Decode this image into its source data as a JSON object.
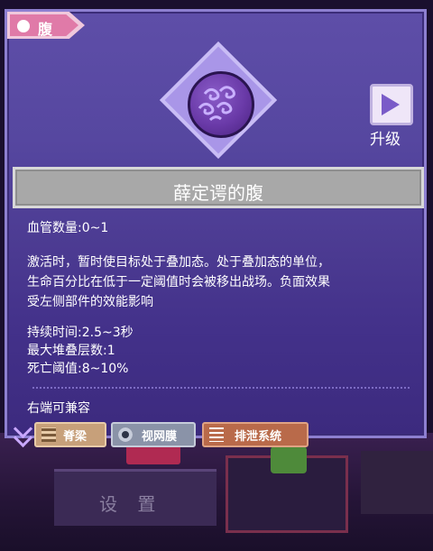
{
  "panel": {
    "title": "腹",
    "item_name": "薛定谔的腹",
    "upgrade_label": "升级"
  },
  "stats": {
    "vessel_count": "血管数量:0~1",
    "description_line1": "激活时，暂时使目标处于叠加态。处于叠加态的单位，",
    "description_line2": "生命百分比在低于一定阈值时会被移出战场。负面效果",
    "description_line3": "受左侧部件的效能影响",
    "duration": "持续时间:2.5~3秒",
    "max_stacks": "最大堆叠层数:1",
    "death_threshold": "死亡阈值:8~10%"
  },
  "compat": {
    "label": "右端可兼容",
    "tags": [
      "脊梁",
      "视网膜",
      "排泄系统"
    ]
  },
  "background": {
    "settings_text": "设 置"
  },
  "colors": {
    "panel_top": "#5e4ea8",
    "panel_bottom": "#3c2a7e",
    "name_bar": "#a8a8a8",
    "title_tag": "#e07aa8"
  },
  "icons": {
    "title": "organ-icon",
    "item": "swirl-orb-icon",
    "upgrade": "arrow-right-icon"
  }
}
